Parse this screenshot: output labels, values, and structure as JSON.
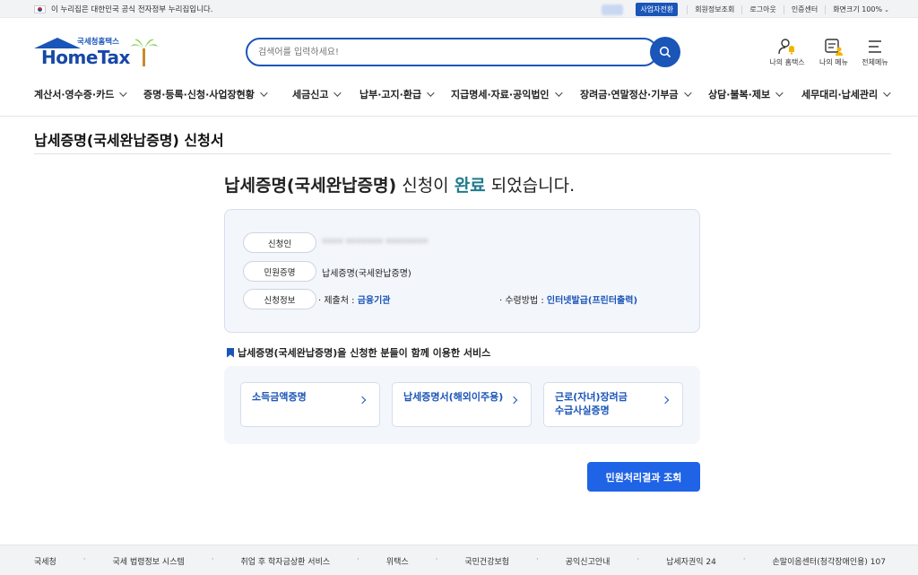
{
  "gov_bar": {
    "notice": "이 누리집은 대한민국 공식 전자정부 누리집입니다.",
    "biz_switch": "사업자전환",
    "links": [
      "회원정보조회",
      "로그아웃",
      "인증센터",
      "화면크기 100%"
    ]
  },
  "logo": {
    "sub": "국세청홈택스",
    "main": "HomeTax"
  },
  "search": {
    "placeholder": "검색어를 입력하세요!"
  },
  "utilities": {
    "my_hometax": "나의 홈택스",
    "my_menu": "나의 메뉴",
    "all_menu": "전체메뉴"
  },
  "nav": [
    "계산서·영수증·카드",
    "증명·등록·신청·사업장현황",
    "세금신고",
    "납부·고지·환급",
    "지급명세·자료·공익법인",
    "장려금·연말정산·기부금",
    "상담·불복·제보",
    "세무대리·납세관리"
  ],
  "page": {
    "title": "납세증명(국세완납증명) 신청서",
    "done_bold": "납세증명(국세완납증명)",
    "done_mid": " 신청이 ",
    "done_accent": "완료",
    "done_end": " 되었습니다."
  },
  "info": {
    "applicant_label": "신청인",
    "applicant_value": "•••• ••••••• ••••••••",
    "civil_label": "민원증명",
    "civil_value": "납세증명(국세완납증명)",
    "apply_label": "신청정보",
    "submit_prefix": "· 제출처 : ",
    "submit_value": "금융기관",
    "receive_prefix": "· 수령방법 : ",
    "receive_value": "인터넷발급(프린터출력)"
  },
  "services": {
    "title": "납세증명(국세완납증명)을 신청한 분들이 함께 이용한 서비스",
    "items": [
      {
        "line1": "소득금액증명",
        "line2": ""
      },
      {
        "line1": "납세증명서(해외이주용)",
        "line2": ""
      },
      {
        "line1": "근로(자녀)장려금",
        "line2": "수급사실증명"
      }
    ]
  },
  "result_button": "민원처리결과 조회",
  "footer": [
    "국세청",
    "국세 법령정보 시스템",
    "취업 후 학자금상환 서비스",
    "위택스",
    "국민건강보험",
    "공익신고안내",
    "납세자권익 24",
    "손말이음센터(청각장애인용) 107"
  ],
  "colors": {
    "brand": "#1a55b8",
    "accent": "#1f7a8c",
    "button": "#1f63e6"
  }
}
